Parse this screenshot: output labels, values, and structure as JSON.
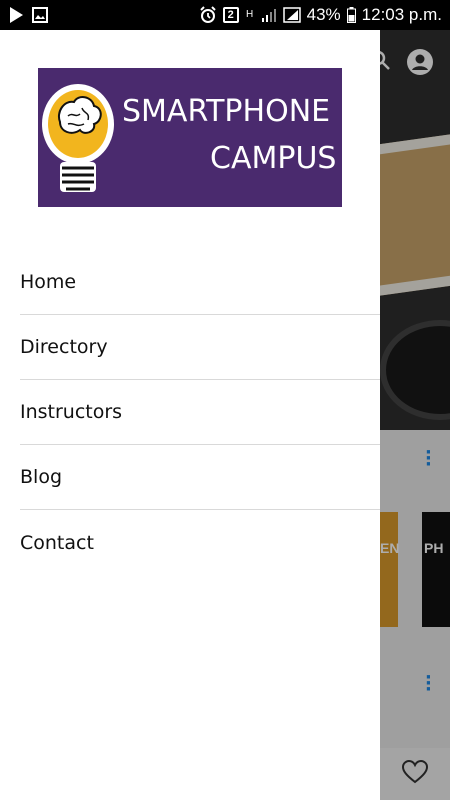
{
  "status_bar": {
    "battery_text": "43%",
    "time": "12:03 p.m.",
    "sim_badge": "2",
    "network_letter": "H"
  },
  "drawer": {
    "logo": {
      "line1": "SMARTPHONE",
      "line2": "CAMPUS",
      "background_color": "#4a2a6e",
      "bulb_color": "#f2b51e"
    },
    "nav_items": [
      {
        "label": "Home"
      },
      {
        "label": "Directory"
      },
      {
        "label": "Instructors"
      },
      {
        "label": "Blog"
      },
      {
        "label": "Contact"
      }
    ]
  },
  "background_app": {
    "card_texts": [
      "EN",
      "PH"
    ],
    "accent_color": "#1e88e5"
  },
  "icons": {
    "status_left": [
      "play-icon",
      "image-icon"
    ],
    "status_right": [
      "alarm-icon",
      "sim-icon",
      "signal-icon",
      "battery-icon"
    ],
    "toolbar": [
      "search-icon",
      "account-icon"
    ],
    "bottom": [
      "heart-icon",
      "more-vert-icon"
    ]
  }
}
